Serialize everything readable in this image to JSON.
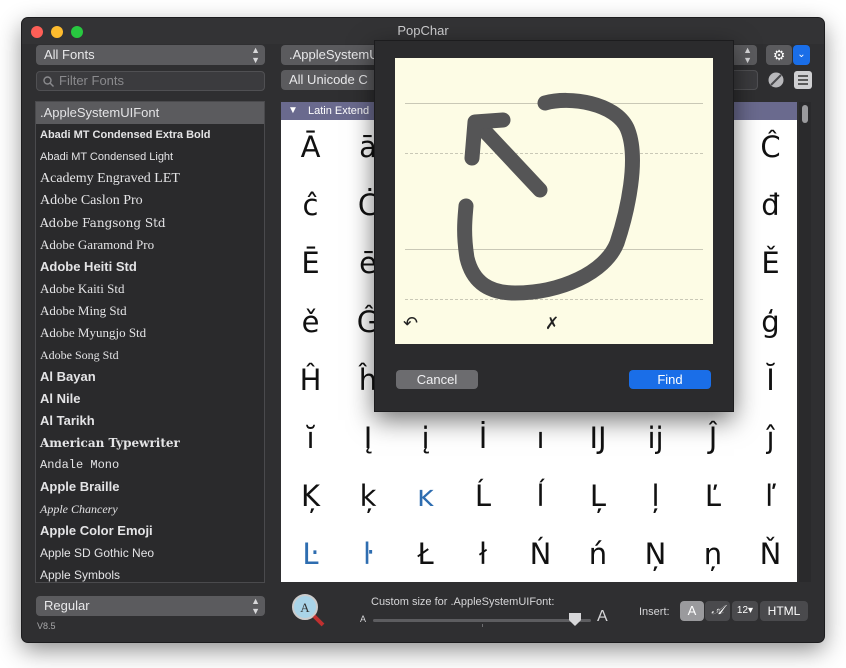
{
  "window": {
    "title": "PopChar"
  },
  "toolbar": {
    "font_filter": "All Fonts",
    "search_placeholder": "Filter Fonts",
    "font_selector": ".AppleSystemUIFont",
    "unicode_selector": "All Unicode C"
  },
  "fonts": [
    ".AppleSystemUIFont",
    "Abadi MT Condensed Extra Bold",
    "Abadi MT Condensed Light",
    "Academy Engraved LET",
    "Adobe Caslon Pro",
    "Adobe Fangsong Std",
    "Adobe Garamond Pro",
    "Adobe Heiti Std",
    "Adobe Kaiti Std",
    "Adobe Ming Std",
    "Adobe Myungjo Std",
    "Adobe Song Std",
    "Al Bayan",
    "Al Nile",
    "Al Tarikh",
    "American Typewriter",
    "Andale Mono",
    "Apple Braille",
    "Apple Chancery",
    "Apple Color Emoji",
    "Apple SD Gothic Neo",
    "Apple Symbols"
  ],
  "section_header": "Latin Extend",
  "chars": [
    [
      "Ā",
      "ā",
      "",
      "",
      "",
      "",
      "",
      "",
      "Ĉ"
    ],
    [
      "ĉ",
      "Ċ",
      "",
      "",
      "",
      "",
      "",
      "",
      "đ"
    ],
    [
      "Ē",
      "ē",
      "",
      "",
      "",
      "",
      "",
      "",
      "Ě"
    ],
    [
      "ě",
      "Ĝ",
      "",
      "",
      "",
      "",
      "",
      "",
      "ģ"
    ],
    [
      "Ĥ",
      "ĥ",
      "",
      "",
      "",
      "",
      "",
      "",
      "Ĭ"
    ],
    [
      "ĭ",
      "Į",
      "į",
      "İ",
      "ı",
      "Ĳ",
      "ĳ",
      "Ĵ",
      "ĵ"
    ],
    [
      "Ķ",
      "ķ",
      "ĸ",
      "Ĺ",
      "ĺ",
      "Ļ",
      "ļ",
      "Ľ",
      "ľ"
    ],
    [
      "Ŀ",
      "ŀ",
      "Ł",
      "ł",
      "Ń",
      "ń",
      "Ņ",
      "ņ",
      "Ň"
    ]
  ],
  "highlighted_chars": [
    "ĸ",
    "Ŀ",
    "ŀ"
  ],
  "dialog": {
    "cancel": "Cancel",
    "find": "Find",
    "undo_icon": "↶",
    "clear_icon": "✗"
  },
  "bottom": {
    "style": "Regular",
    "version": "V8.5",
    "size_label": "Custom size for .AppleSystemUIFont:",
    "small_a": "A",
    "big_a": "A",
    "insert_label": "Insert:",
    "insert_a": "A",
    "insert_script": "𝒜",
    "insert_size": "12▾",
    "insert_html": "HTML"
  },
  "colors": {
    "accent": "#1a6ee8",
    "highlight_char": "#2e6db0",
    "section": "#6a6a8e"
  }
}
